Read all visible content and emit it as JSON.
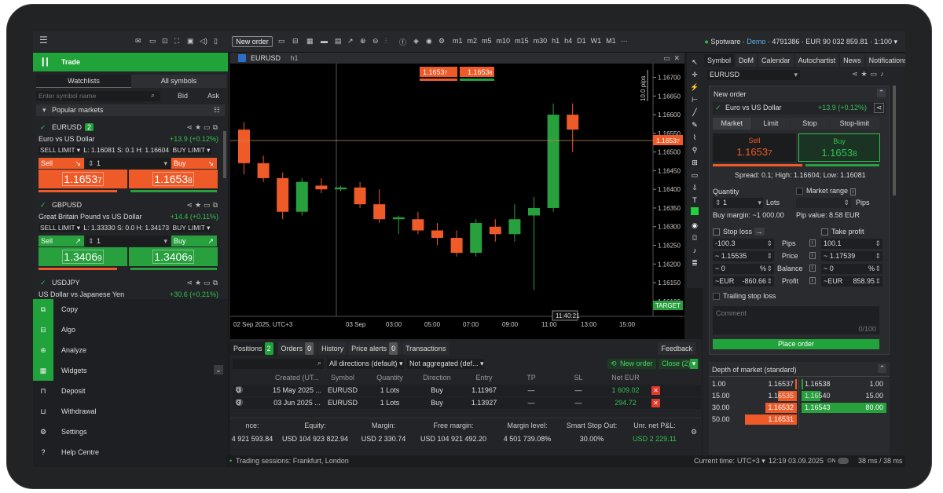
{
  "topbar": {
    "new_order": "New order",
    "account_broker": "Spotware",
    "account_sep1": " · ",
    "account_type": "Demo",
    "account_info": " · 4791386 · EUR 90 032 859.81 · 1:100 ▾",
    "timeframes": [
      "m1",
      "m2",
      "m5",
      "m10",
      "m15",
      "m30",
      "h1",
      "h4",
      "D1",
      "W1",
      "M1"
    ]
  },
  "left": {
    "trade_label": "Trade",
    "tabs": [
      "Watchlists",
      "All symbols"
    ],
    "search_placeholder": "Enter symbol name",
    "bid": "Bid",
    "ask": "Ask",
    "popular": "Popular markets",
    "symbols": [
      {
        "name": "EURUSD",
        "count": "2",
        "desc": "Euro vs US Dollar",
        "change": "+13.9 (+0.12%)",
        "sell_limit": "SELL LIMIT ▾",
        "limits": "L: 1.16081 S: 0.1 H: 1.16604",
        "buy_limit": "BUY LIMIT ▾",
        "sell": "Sell",
        "buy": "Buy",
        "qty": "1",
        "sell_price": "1.1653",
        "sell_pip": "7",
        "buy_price": "1.1653",
        "buy_pip": "8"
      },
      {
        "name": "GBPUSD",
        "desc": "Great Britain Pound vs US Dollar",
        "change": "+14.4 (+0.11%)",
        "sell_limit": "SELL LIMIT ▾",
        "limits": "L: 1.33330 S: 0.0 H: 1.34173",
        "buy_limit": "BUY LIMIT ▾",
        "sell": "Sell",
        "buy": "Buy",
        "qty": "1",
        "sell_price": "1.3406",
        "sell_pip": "9",
        "buy_price": "1.3406",
        "buy_pip": "9"
      },
      {
        "name": "USDJPY",
        "desc": "US Dollar vs Japanese Yen",
        "change": "+30.6 (+0.21%)"
      }
    ],
    "menu": [
      {
        "label": "Copy",
        "icon": "copy-icon"
      },
      {
        "label": "Algo",
        "icon": "algo-icon"
      },
      {
        "label": "Analyze",
        "icon": "analyze-icon"
      },
      {
        "label": "Widgets",
        "icon": "widgets-icon"
      },
      {
        "label": "Deposit",
        "icon": "deposit-icon"
      },
      {
        "label": "Withdrawal",
        "icon": "withdrawal-icon"
      },
      {
        "label": "Settings",
        "icon": "gear-icon"
      },
      {
        "label": "Help Centre",
        "icon": "help-icon"
      }
    ]
  },
  "chart": {
    "symbol": "EURUSD",
    "timeframe": "h1",
    "pips_label": "10.0 pips",
    "target_label": "TARGET",
    "crosshair_time": "11:40:21",
    "sell_box": "1.1653",
    "sell_box_pip": "7",
    "buy_box": "1.1653",
    "buy_box_pip": "8",
    "current_price": "1.1653",
    "current_pip": "7",
    "chart_data": {
      "type": "candlestick",
      "x": [
        "02 Sep 2025, UTC+3",
        "03 Sep",
        "03:00",
        "05:00",
        "07:00",
        "09:00",
        "11:00",
        "13:00",
        "15:00"
      ],
      "y_ticks": [
        "1.16700",
        "1.16650",
        "1.16600",
        "1.16550",
        "1.16500",
        "1.16450",
        "1.16400",
        "1.16350",
        "1.16300",
        "1.16250",
        "1.16200",
        "1.16150",
        "1.16100"
      ],
      "ylim": [
        1.16085,
        1.1672
      ],
      "candles": [
        [
          1.1656,
          1.1658,
          1.1644,
          1.1647
        ],
        [
          1.1647,
          1.1649,
          1.1642,
          1.1643
        ],
        [
          1.1643,
          1.16445,
          1.1632,
          1.1634
        ],
        [
          1.1634,
          1.1643,
          1.1633,
          1.1642
        ],
        [
          1.1641,
          1.1643,
          1.1639,
          1.164
        ],
        [
          1.164,
          1.1641,
          1.16395,
          1.16405
        ],
        [
          1.16405,
          1.1642,
          1.1635,
          1.1636
        ],
        [
          1.1636,
          1.164,
          1.1631,
          1.1632
        ],
        [
          1.1632,
          1.1633,
          1.1628,
          1.16325
        ],
        [
          1.1632,
          1.1634,
          1.1628,
          1.1629
        ],
        [
          1.1629,
          1.1631,
          1.1625,
          1.1627
        ],
        [
          1.1627,
          1.1629,
          1.1622,
          1.1623
        ],
        [
          1.1623,
          1.1632,
          1.1622,
          1.1631
        ],
        [
          1.163,
          1.1632,
          1.1626,
          1.1628
        ],
        [
          1.1628,
          1.1636,
          1.1626,
          1.1632
        ],
        [
          1.1633,
          1.1638,
          1.1613,
          1.1635
        ],
        [
          1.1635,
          1.1663,
          1.1634,
          1.166
        ],
        [
          1.166,
          1.1663,
          1.165,
          1.1656
        ]
      ]
    }
  },
  "bottom": {
    "tabs": [
      {
        "label": "Positions",
        "count": "2"
      },
      {
        "label": "Orders",
        "count": "0"
      },
      {
        "label": "History"
      },
      {
        "label": "Price alerts",
        "count": "0"
      },
      {
        "label": "Transactions"
      }
    ],
    "feedback": "Feedback",
    "directions": "All directions (default) ▾",
    "aggregation": "Not aggregated (def... ▾",
    "new_order": "New order",
    "close": "Close (2)",
    "columns": [
      "Created (UT...",
      "Symbol",
      "Quantity",
      "Direction",
      "Entry",
      "TP",
      "SL",
      "Net EUR"
    ],
    "rows": [
      {
        "created": "15 May 2025 ...",
        "symbol": "EURUSD",
        "qty": "1 Lots",
        "dir": "Buy",
        "entry": "1.11967",
        "tp": "—",
        "sl": "—",
        "net": "1 609.02"
      },
      {
        "created": "03 Jun 2025 ...",
        "symbol": "EURUSD",
        "qty": "1 Lots",
        "dir": "Buy",
        "entry": "1.13927",
        "tp": "—",
        "sl": "—",
        "net": "294.72"
      }
    ],
    "summary": [
      {
        "label": "nce:",
        "value": "4 921 593.84"
      },
      {
        "label": "Equity:",
        "value": "USD 104 923 822.94"
      },
      {
        "label": "Margin:",
        "value": "USD 2 330.74"
      },
      {
        "label": "Free margin:",
        "value": "USD 104 921 492.20"
      },
      {
        "label": "Margin level:",
        "value": "4 501 739.08%"
      },
      {
        "label": "Smart Stop Out:",
        "value": "30.00%"
      },
      {
        "label": "Unr. net P&L:",
        "value": "USD 2 229.11"
      }
    ]
  },
  "status": {
    "sessions": "Trading sessions: Frankfurt, London",
    "time_label": "Current time:",
    "tz": "UTC+3 ▾",
    "time": "12:19 03.09.2025",
    "on": "ON",
    "latency": "38 ms / 38 ms"
  },
  "right": {
    "tabs": [
      "Symbol",
      "DoM",
      "Calendar",
      "Autochartist",
      "News",
      "Notifications"
    ],
    "symbol": "EURUSD",
    "new_order": "New order",
    "sym_name": "Euro vs US Dollar",
    "change": "+13.9 (+0.12%)",
    "order_types": [
      "Market",
      "Limit",
      "Stop",
      "Stop-limit"
    ],
    "sell": "Sell",
    "buy": "Buy",
    "sell_price": "1.1653",
    "sell_pip": "7",
    "buy_price": "1.1653",
    "buy_pip": "8",
    "spread": "Spread: 0.1; High: 1.16604; Low: 1.16081",
    "quantity": "Quantity",
    "market_range": "Market range",
    "qty": "1",
    "lots": "Lots",
    "pips": "Pips",
    "buy_margin": "Buy margin: ~1 000.00",
    "pip_value": "Pip value: 8.58 EUR",
    "stop_loss": "Stop loss",
    "take_profit": "Take profit",
    "sl_pips": "-100.3",
    "tp_pips": "100.1",
    "sl_price": "~ 1.15535",
    "tp_price": "~ 1.17539",
    "sl_bal": "~ 0",
    "tp_bal": "~ 0",
    "pct": "%",
    "sl_eur": "~EUR",
    "sl_profit": "-860.66",
    "tp_eur": "~EUR",
    "tp_profit": "858.95",
    "lbl_pips": "Pips",
    "lbl_price": "Price",
    "lbl_balance": "Balance",
    "lbl_profit": "Profit",
    "trailing": "Trailing stop loss",
    "comment": "Comment",
    "comment_count": "0/100",
    "place": "Place order",
    "dom_title": "Depth of market (standard)",
    "dom_sell": [
      {
        "vol": "1.00",
        "price": "1.16537"
      },
      {
        "vol": "15.00",
        "price": "1.16535"
      },
      {
        "vol": "30.00",
        "price": "1.16532"
      },
      {
        "vol": "50.00",
        "price": "1.16531"
      }
    ],
    "dom_buy": [
      {
        "vol": "1.00",
        "price": "1.16538"
      },
      {
        "vol": "15.00",
        "price": "1.16540"
      },
      {
        "vol": "80.00",
        "price": "1.16543"
      }
    ]
  }
}
